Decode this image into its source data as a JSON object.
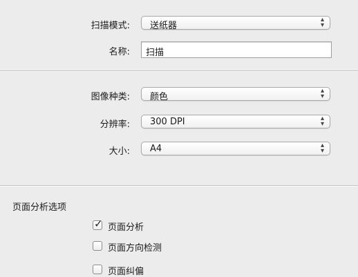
{
  "scan_mode": {
    "label": "扫描模式:",
    "value": "送纸器"
  },
  "name": {
    "label": "名称:",
    "value": "扫描"
  },
  "image_type": {
    "label": "图像种类:",
    "value": "颜色"
  },
  "resolution": {
    "label": "分辨率:",
    "value": "300 DPI"
  },
  "size": {
    "label": "大小:",
    "value": "A4"
  },
  "analysis": {
    "title": "页面分析选项",
    "options": [
      {
        "label": "页面分析",
        "checked": true
      },
      {
        "label": "页面方向检测",
        "checked": false
      },
      {
        "label": "页面纠偏",
        "checked": false
      }
    ]
  },
  "icons": {
    "popup_arrows": "up-down-chevron-icon",
    "check": "checkmark-icon"
  }
}
